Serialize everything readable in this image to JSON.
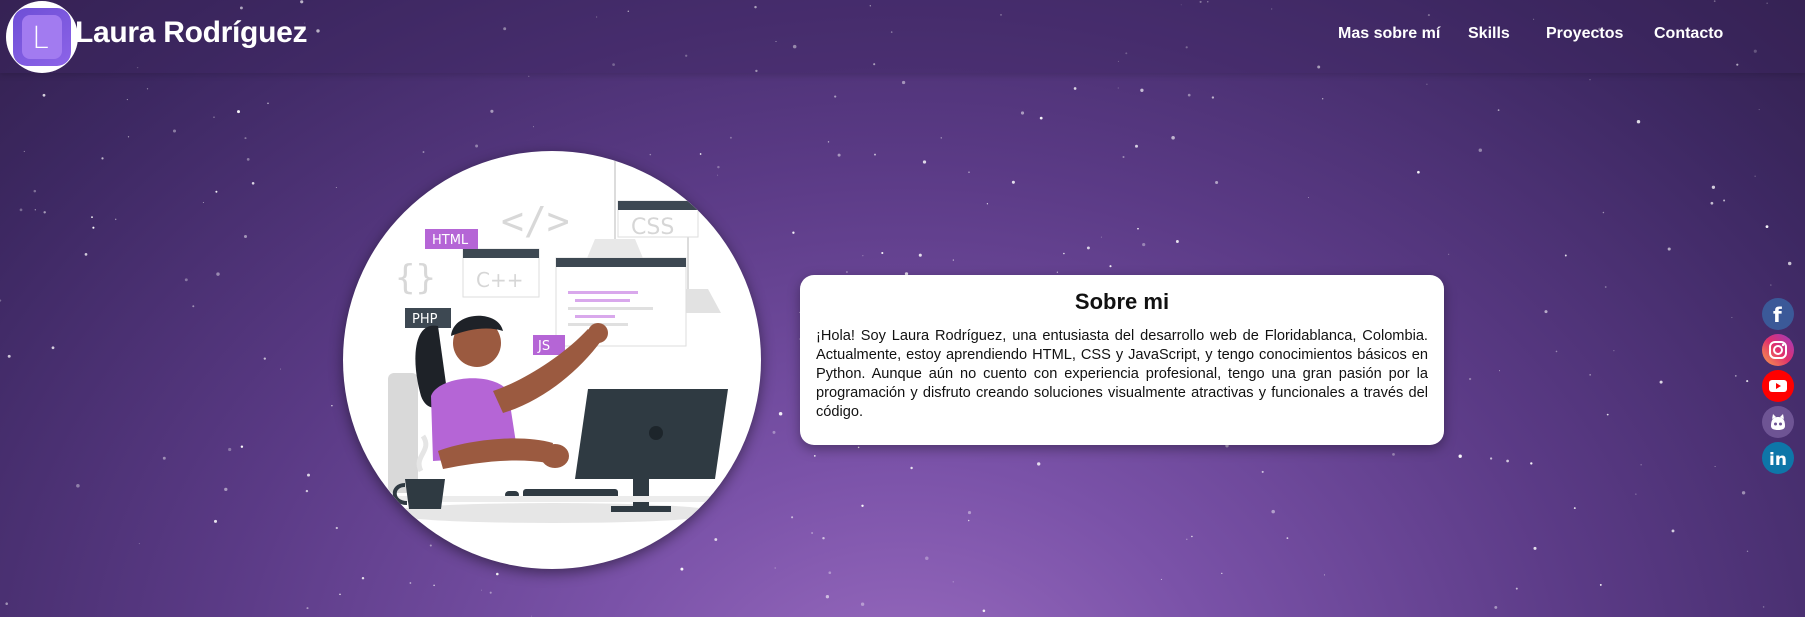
{
  "brand": {
    "name": "Laura Rodríguez",
    "logo_letter": "L"
  },
  "nav": {
    "items": [
      "Mas sobre mí",
      "Skills",
      "Proyectos",
      "Contacto"
    ]
  },
  "illustration": {
    "tags": [
      "HTML",
      "PHP",
      "JS",
      "CSS",
      "C++"
    ],
    "symbols": [
      "</>",
      "{}"
    ]
  },
  "about": {
    "title": "Sobre mi",
    "text": "¡Hola! Soy Laura Rodríguez, una entusiasta del desarrollo web de Floridablanca, Colombia. Actualmente, estoy aprendiendo HTML, CSS y JavaScript, y tengo conocimientos básicos en Python. Aunque aún no cuento con experiencia profesional, tengo una gran pasión por la programación y disfruto creando soluciones visualmente atractivas y funcionales a través del código."
  },
  "social": [
    {
      "name": "facebook-icon",
      "label": "f",
      "color": "#3b5998"
    },
    {
      "name": "instagram-icon",
      "label": "",
      "color": "#e1306c"
    },
    {
      "name": "youtube-icon",
      "label": "",
      "color": "#ff0000"
    },
    {
      "name": "github-icon",
      "label": "",
      "color": "#6e5494"
    },
    {
      "name": "linkedin-icon",
      "label": "in",
      "color": "#0e76a8"
    }
  ],
  "colors": {
    "background_center": "#9a6cc0",
    "background_edge": "#33214f",
    "card_bg": "#ffffff",
    "tag_purple": "#b565d6",
    "tag_dark": "#3d4852"
  }
}
